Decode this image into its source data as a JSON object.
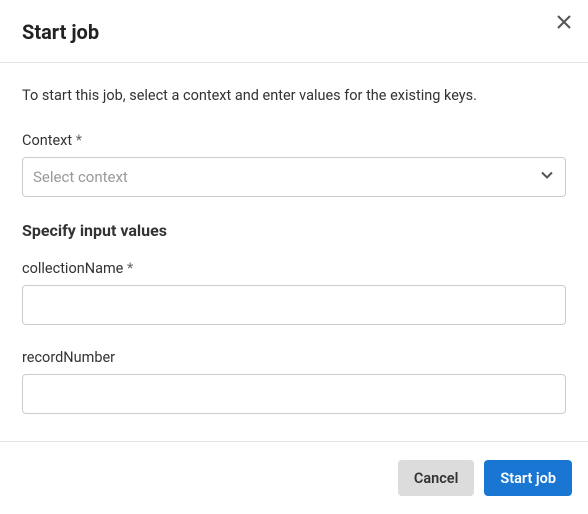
{
  "header": {
    "title": "Start job"
  },
  "body": {
    "description": "To start this job, select a context and enter values for the existing keys.",
    "context": {
      "label": "Context",
      "required_marker": "*",
      "placeholder": "Select context"
    },
    "section_title": "Specify input values",
    "fields": [
      {
        "label": "collectionName",
        "required_marker": "*",
        "value": ""
      },
      {
        "label": "recordNumber",
        "required_marker": "",
        "value": ""
      }
    ]
  },
  "footer": {
    "cancel": "Cancel",
    "submit": "Start job"
  }
}
